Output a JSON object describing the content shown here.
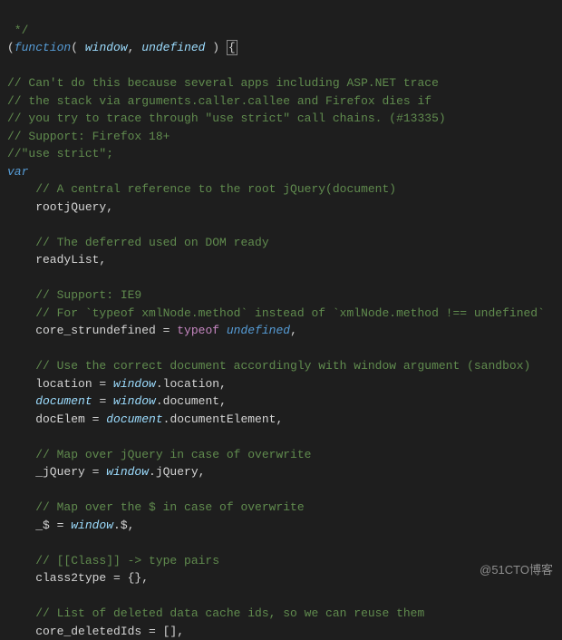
{
  "code": {
    "line1": " */",
    "line2_a": "(",
    "line2_b": "function",
    "line2_c": "( ",
    "line2_d": "window",
    "line2_e": ", ",
    "line2_f": "undefined",
    "line2_g": " ) ",
    "line2_h": "{",
    "line3": "",
    "line4": "// Can't do this because several apps including ASP.NET trace",
    "line5": "// the stack via arguments.caller.callee and Firefox dies if",
    "line6": "// you try to trace through \"use strict\" call chains. (#13335)",
    "line7": "// Support: Firefox 18+",
    "line8": "//\"use strict\";",
    "line9": "var",
    "line10": "    // A central reference to the root jQuery(document)",
    "line11": "    rootjQuery,",
    "line12": "",
    "line13": "    // The deferred used on DOM ready",
    "line14": "    readyList,",
    "line15": "",
    "line16": "    // Support: IE9",
    "line17": "    // For `typeof xmlNode.method` instead of `xmlNode.method !== undefined`",
    "line18_a": "    core_strundefined = ",
    "line18_b": "typeof",
    "line18_c": " ",
    "line18_d": "undefined",
    "line18_e": ",",
    "line19": "",
    "line20": "    // Use the correct document accordingly with window argument (sandbox)",
    "line21_a": "    location = ",
    "line21_b": "window",
    "line21_c": ".location,",
    "line22_a": "    ",
    "line22_b": "document",
    "line22_c": " = ",
    "line22_d": "window",
    "line22_e": ".document,",
    "line23_a": "    docElem = ",
    "line23_b": "document",
    "line23_c": ".documentElement,",
    "line24": "",
    "line25": "    // Map over jQuery in case of overwrite",
    "line26_a": "    _jQuery = ",
    "line26_b": "window",
    "line26_c": ".jQuery,",
    "line27": "",
    "line28": "    // Map over the $ in case of overwrite",
    "line29_a": "    _$ = ",
    "line29_b": "window",
    "line29_c": ".$,",
    "line30": "",
    "line31": "    // [[Class]] -> type pairs",
    "line32": "    class2type = {},",
    "line33": "",
    "line34": "    // List of deleted data cache ids, so we can reuse them",
    "line35": "    core_deletedIds = [],"
  },
  "watermark": "@51CTO博客"
}
